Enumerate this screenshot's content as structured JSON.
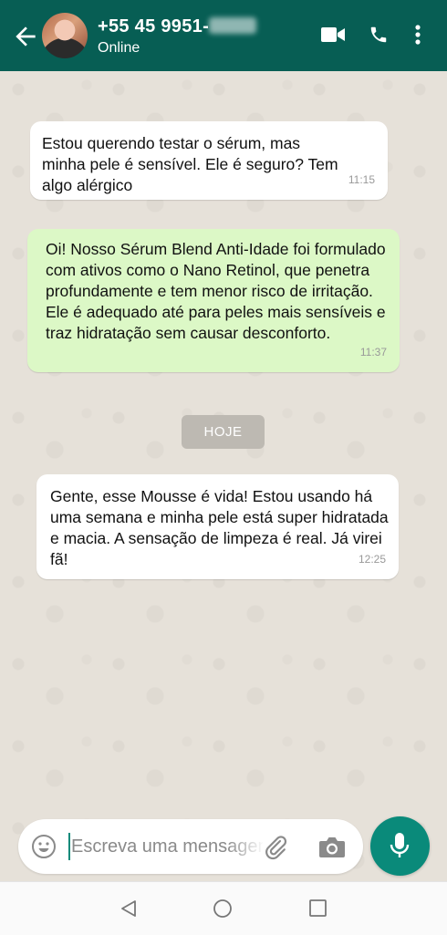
{
  "header": {
    "contact_name": "+55 45 9951-",
    "status": "Online"
  },
  "messages": [
    {
      "direction": "in",
      "text": "Estou querendo testar o sérum, mas minha pele é sensível. Ele é seguro? Tem algo alérgico",
      "time": "11:15"
    },
    {
      "direction": "out",
      "text": "Oi! Nosso Sérum Blend Anti-Idade foi formulado com ativos como o Nano Retinol, que penetra profundamente e tem menor risco de irritação. Ele é adequado até para peles mais sensíveis e traz hidratação sem causar desconforto.",
      "time": "11:37"
    },
    {
      "direction": "in",
      "text": "Gente, esse Mousse é vida! Estou usando há uma semana e minha pele está super hidratada e macia. A sensação de limpeza é real. Já virei fã!",
      "time": "12:25"
    }
  ],
  "date_chip": "HOJE",
  "composer": {
    "placeholder": "Escreva uma mensagem"
  },
  "colors": {
    "header": "#075e54",
    "accent": "#0a8a7a",
    "outgoing_bubble": "#dcf8c6",
    "incoming_bubble": "#ffffff"
  },
  "icons": [
    "back-arrow-icon",
    "video-call-icon",
    "phone-icon",
    "more-vert-icon",
    "emoji-icon",
    "paperclip-icon",
    "camera-icon",
    "mic-icon",
    "nav-back-icon",
    "nav-home-icon",
    "nav-recent-icon"
  ]
}
